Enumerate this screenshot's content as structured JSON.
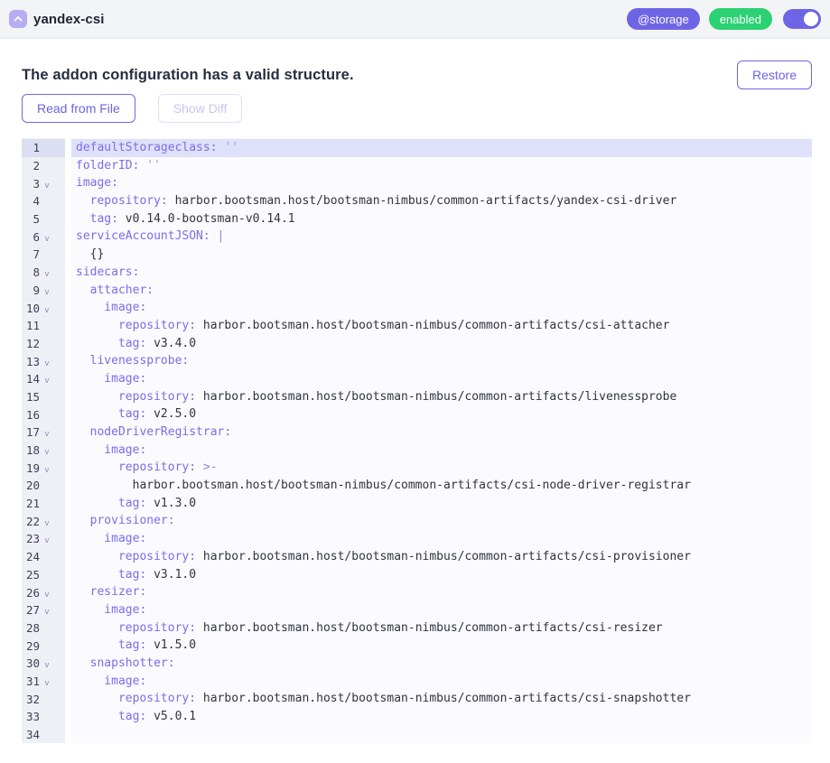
{
  "header": {
    "title": "yandex-csi",
    "badges": {
      "category": "@storage",
      "status": "enabled"
    },
    "toggle_on": true
  },
  "panel": {
    "status_message": "The addon configuration has a valid structure.",
    "restore_label": "Restore",
    "read_from_file_label": "Read from File",
    "show_diff_label": "Show Diff"
  },
  "colors": {
    "accent_purple": "#6e65e6",
    "status_green": "#2bd173",
    "key_purple": "#7b6ee6",
    "value_dark": "#32333d",
    "active_line_bg": "#dfe1fb",
    "gutter_bg": "#eef0f6",
    "code_bg": "#fafaff"
  },
  "editor": {
    "active_line": 1,
    "lines": [
      {
        "n": 1,
        "fold": false,
        "parts": [
          [
            "k",
            "defaultStorageclass:"
          ],
          [
            "q",
            " ''"
          ]
        ]
      },
      {
        "n": 2,
        "fold": false,
        "parts": [
          [
            "k",
            "folderID:"
          ],
          [
            "q",
            " ''"
          ]
        ]
      },
      {
        "n": 3,
        "fold": true,
        "parts": [
          [
            "k",
            "image:"
          ]
        ]
      },
      {
        "n": 4,
        "fold": false,
        "parts": [
          [
            "k",
            "  repository:"
          ],
          [
            "v",
            " harbor.bootsman.host/bootsman-nimbus/common-artifacts/yandex-csi-driver"
          ]
        ]
      },
      {
        "n": 5,
        "fold": false,
        "parts": [
          [
            "k",
            "  tag:"
          ],
          [
            "v",
            " v0.14.0-bootsman-v0.14.1"
          ]
        ]
      },
      {
        "n": 6,
        "fold": true,
        "parts": [
          [
            "k",
            "serviceAccountJSON:"
          ],
          [
            "b",
            " |"
          ]
        ]
      },
      {
        "n": 7,
        "fold": false,
        "parts": [
          [
            "v",
            "  {}"
          ]
        ]
      },
      {
        "n": 8,
        "fold": true,
        "parts": [
          [
            "k",
            "sidecars:"
          ]
        ]
      },
      {
        "n": 9,
        "fold": true,
        "parts": [
          [
            "k",
            "  attacher:"
          ]
        ]
      },
      {
        "n": 10,
        "fold": true,
        "parts": [
          [
            "k",
            "    image:"
          ]
        ]
      },
      {
        "n": 11,
        "fold": false,
        "parts": [
          [
            "k",
            "      repository:"
          ],
          [
            "v",
            " harbor.bootsman.host/bootsman-nimbus/common-artifacts/csi-attacher"
          ]
        ]
      },
      {
        "n": 12,
        "fold": false,
        "parts": [
          [
            "k",
            "      tag:"
          ],
          [
            "v",
            " v3.4.0"
          ]
        ]
      },
      {
        "n": 13,
        "fold": true,
        "parts": [
          [
            "k",
            "  livenessprobe:"
          ]
        ]
      },
      {
        "n": 14,
        "fold": true,
        "parts": [
          [
            "k",
            "    image:"
          ]
        ]
      },
      {
        "n": 15,
        "fold": false,
        "parts": [
          [
            "k",
            "      repository:"
          ],
          [
            "v",
            " harbor.bootsman.host/bootsman-nimbus/common-artifacts/livenessprobe"
          ]
        ]
      },
      {
        "n": 16,
        "fold": false,
        "parts": [
          [
            "k",
            "      tag:"
          ],
          [
            "v",
            " v2.5.0"
          ]
        ]
      },
      {
        "n": 17,
        "fold": true,
        "parts": [
          [
            "k",
            "  nodeDriverRegistrar:"
          ]
        ]
      },
      {
        "n": 18,
        "fold": true,
        "parts": [
          [
            "k",
            "    image:"
          ]
        ]
      },
      {
        "n": 19,
        "fold": true,
        "parts": [
          [
            "k",
            "      repository:"
          ],
          [
            "b",
            " >-"
          ]
        ]
      },
      {
        "n": 20,
        "fold": false,
        "parts": [
          [
            "v",
            "        harbor.bootsman.host/bootsman-nimbus/common-artifacts/csi-node-driver-registrar"
          ]
        ]
      },
      {
        "n": 21,
        "fold": false,
        "parts": [
          [
            "k",
            "      tag:"
          ],
          [
            "v",
            " v1.3.0"
          ]
        ]
      },
      {
        "n": 22,
        "fold": true,
        "parts": [
          [
            "k",
            "  provisioner:"
          ]
        ]
      },
      {
        "n": 23,
        "fold": true,
        "parts": [
          [
            "k",
            "    image:"
          ]
        ]
      },
      {
        "n": 24,
        "fold": false,
        "parts": [
          [
            "k",
            "      repository:"
          ],
          [
            "v",
            " harbor.bootsman.host/bootsman-nimbus/common-artifacts/csi-provisioner"
          ]
        ]
      },
      {
        "n": 25,
        "fold": false,
        "parts": [
          [
            "k",
            "      tag:"
          ],
          [
            "v",
            " v3.1.0"
          ]
        ]
      },
      {
        "n": 26,
        "fold": true,
        "parts": [
          [
            "k",
            "  resizer:"
          ]
        ]
      },
      {
        "n": 27,
        "fold": true,
        "parts": [
          [
            "k",
            "    image:"
          ]
        ]
      },
      {
        "n": 28,
        "fold": false,
        "parts": [
          [
            "k",
            "      repository:"
          ],
          [
            "v",
            " harbor.bootsman.host/bootsman-nimbus/common-artifacts/csi-resizer"
          ]
        ]
      },
      {
        "n": 29,
        "fold": false,
        "parts": [
          [
            "k",
            "      tag:"
          ],
          [
            "v",
            " v1.5.0"
          ]
        ]
      },
      {
        "n": 30,
        "fold": true,
        "parts": [
          [
            "k",
            "  snapshotter:"
          ]
        ]
      },
      {
        "n": 31,
        "fold": true,
        "parts": [
          [
            "k",
            "    image:"
          ]
        ]
      },
      {
        "n": 32,
        "fold": false,
        "parts": [
          [
            "k",
            "      repository:"
          ],
          [
            "v",
            " harbor.bootsman.host/bootsman-nimbus/common-artifacts/csi-snapshotter"
          ]
        ]
      },
      {
        "n": 33,
        "fold": false,
        "parts": [
          [
            "k",
            "      tag:"
          ],
          [
            "v",
            " v5.0.1"
          ]
        ]
      },
      {
        "n": 34,
        "fold": false,
        "parts": []
      }
    ]
  }
}
